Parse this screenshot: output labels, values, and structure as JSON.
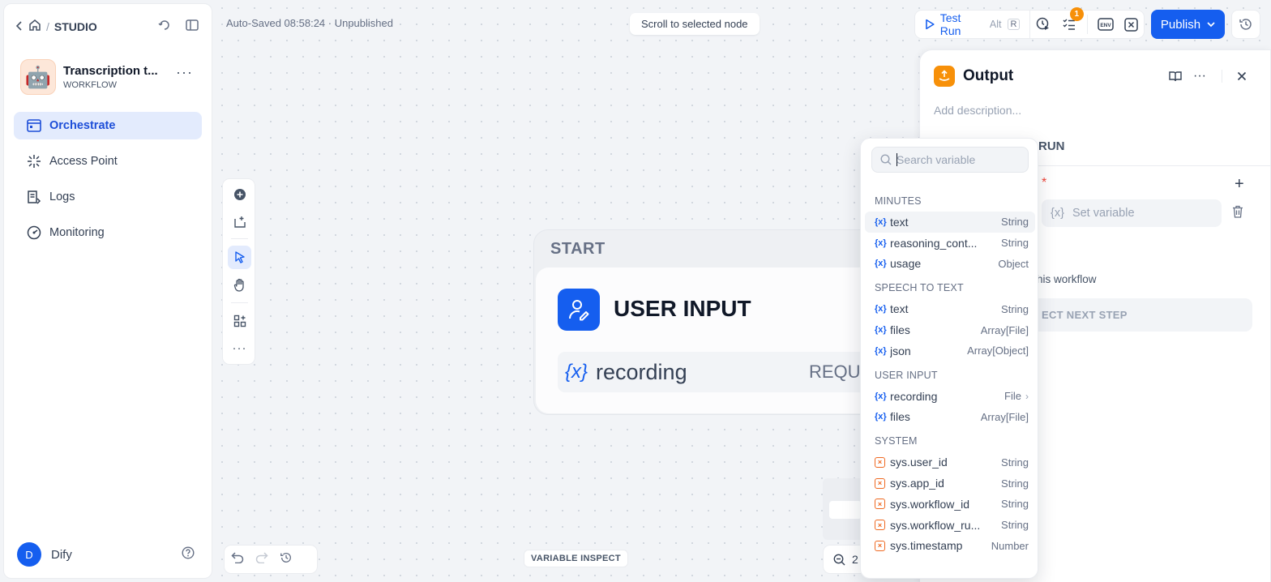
{
  "sidebar": {
    "breadcrumb": "STUDIO",
    "app": {
      "name": "Transcription t...",
      "type": "WORKFLOW",
      "avatar": "🤖"
    },
    "nav": [
      {
        "label": "Orchestrate",
        "icon": "orchestrate-icon",
        "active": true
      },
      {
        "label": "Access Point",
        "icon": "access-point-icon",
        "active": false
      },
      {
        "label": "Logs",
        "icon": "logs-icon",
        "active": false
      },
      {
        "label": "Monitoring",
        "icon": "monitoring-icon",
        "active": false
      }
    ],
    "user": {
      "initial": "D",
      "name": "Dify"
    }
  },
  "header": {
    "autosave": "Auto-Saved 08:58:24 · Unpublished",
    "scroll_button": "Scroll to selected node",
    "test_run": {
      "label": "Test Run",
      "shortcut_a": "Alt",
      "shortcut_b": "R"
    },
    "checklist_badge": "1",
    "env_label": "ENV",
    "publish": "Publish"
  },
  "canvas": {
    "variable_inspect": "VARIABLE INSPECT",
    "zoom": "2"
  },
  "start_node": {
    "label": "START",
    "title": "USER INPUT",
    "variable": {
      "symbol": "{x}",
      "name": "recording",
      "required": "REQUI"
    }
  },
  "output_panel": {
    "title": "Output",
    "description_placeholder": "Add description...",
    "tab": "RUN",
    "required_mark": "*",
    "set_variable": "Set variable",
    "var_symbol": "{x}",
    "workflow_text": "his workflow",
    "next_step": "ECT NEXT STEP"
  },
  "dropdown": {
    "search_placeholder": "Search variable",
    "groups": [
      {
        "title": "MINUTES",
        "items": [
          {
            "name": "text",
            "type": "String",
            "hover": true
          },
          {
            "name": "reasoning_cont...",
            "type": "String"
          },
          {
            "name": "usage",
            "type": "Object"
          }
        ]
      },
      {
        "title": "SPEECH TO TEXT",
        "items": [
          {
            "name": "text",
            "type": "String"
          },
          {
            "name": "files",
            "type": "Array[File]"
          },
          {
            "name": "json",
            "type": "Array[Object]"
          }
        ]
      },
      {
        "title": "USER INPUT",
        "items": [
          {
            "name": "recording",
            "type": "File",
            "chevron": true
          },
          {
            "name": "files",
            "type": "Array[File]"
          }
        ]
      },
      {
        "title": "SYSTEM",
        "system": true,
        "items": [
          {
            "name": "sys.user_id",
            "type": "String"
          },
          {
            "name": "sys.app_id",
            "type": "String"
          },
          {
            "name": "sys.workflow_id",
            "type": "String"
          },
          {
            "name": "sys.workflow_ru...",
            "type": "String"
          },
          {
            "name": "sys.timestamp",
            "type": "Number"
          }
        ]
      }
    ]
  },
  "colors": {
    "accent": "#155eef",
    "output_icon": "#f79009",
    "system_var": "#ef6820",
    "badge": "#f79009"
  }
}
